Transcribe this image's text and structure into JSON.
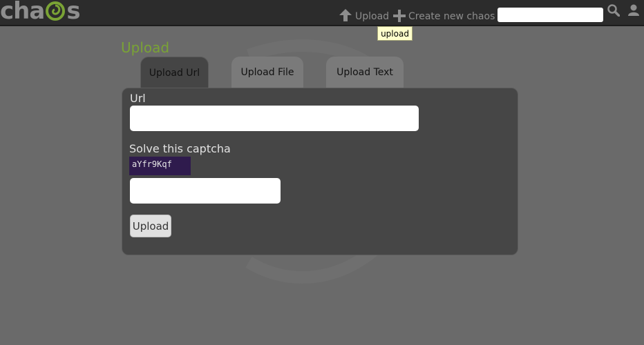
{
  "header": {
    "logo_text_left": "cha",
    "logo_text_right": "s",
    "nav": {
      "upload_label": "Upload",
      "create_label": "Create new chaos"
    },
    "search": {
      "placeholder": "",
      "value": ""
    },
    "tooltip": "upload"
  },
  "main": {
    "title": "Upload",
    "tabs": [
      {
        "label": "Upload Url",
        "active": true
      },
      {
        "label": "Upload File",
        "active": false
      },
      {
        "label": "Upload Text",
        "active": false
      }
    ],
    "form": {
      "url_label": "Url",
      "url_value": "",
      "captcha_label": "Solve this captcha",
      "captcha_text": "aYfr9Kqf",
      "captcha_value": "",
      "submit_label": "Upload"
    }
  },
  "colors": {
    "accent_green": "#7aa335",
    "topbar": "#2c2c2c",
    "panel": "#464646",
    "captcha_bg": "#2f1b4d"
  },
  "icons": [
    "logo-swirl-icon",
    "upload-arrow-icon",
    "plus-icon",
    "search-icon",
    "user-icon"
  ]
}
